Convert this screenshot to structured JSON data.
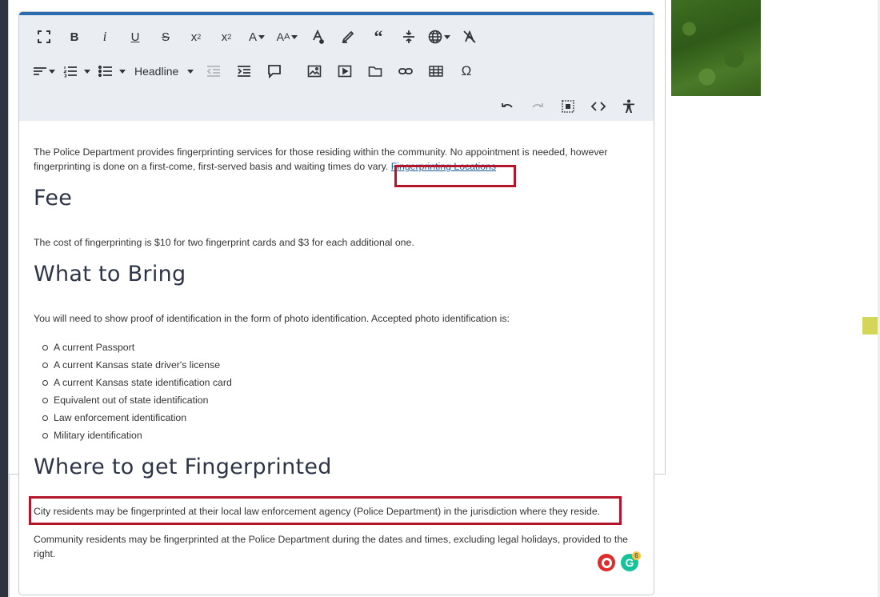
{
  "toolbar": {
    "row1": [
      "fullscreen",
      "bold",
      "italic",
      "underline",
      "strikethrough",
      "subscript",
      "superscript",
      "font-color",
      "font-size",
      "background-color",
      "highlight",
      "quote",
      "horizontal-rule",
      "language",
      "clear-format"
    ],
    "headline_label": "Headline",
    "undo": "undo",
    "redo": "redo"
  },
  "content": {
    "intro": "The Police Department provides fingerprinting services for those residing within the community. No appointment is needed, however fingerprinting is done on a first-come, first-served basis and waiting times do vary.",
    "intro_link": "Fingerprinting Locations",
    "fee_heading": "Fee",
    "fee_text": "The cost of fingerprinting is $10 for two fingerprint cards and $3 for each additional one.",
    "bring_heading": "What to Bring",
    "bring_text": "You will need to show proof of identification in the form of photo identification. Accepted photo identification is:",
    "id_list": [
      "A current Passport",
      "A current Kansas state driver's license",
      "A current Kansas state identification card",
      "Equivalent out of state identification",
      "Law enforcement identification",
      "Military identification"
    ],
    "where_heading": "Where to get Fingerprinted",
    "city_text": "City residents may be fingerprinted at their local law enforcement agency (Police Department) in the jurisdiction where they reside.",
    "community_text": "Community residents may be fingerprinted at the Police Department during the dates and times, excluding legal holidays, provided to the right."
  },
  "widgets": {
    "grammarly_letter": "G",
    "grammarly_count": "6"
  },
  "colors": {
    "accent": "#2b6cb0",
    "highlight_border": "#b5152b",
    "link": "#1f5f9c"
  }
}
